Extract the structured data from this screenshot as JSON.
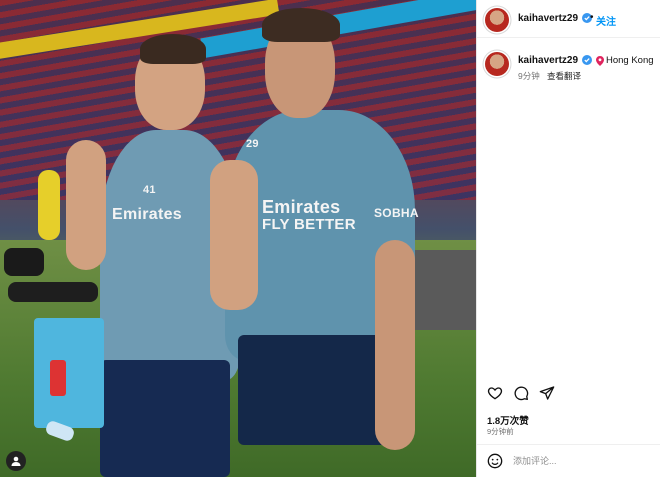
{
  "post": {
    "username": "kaihavertz29",
    "follow_label": "关注",
    "separator": "•",
    "location": "Hong Kong",
    "time_ago": "9分钟",
    "translate_label": "查看翻译",
    "likes": "1.8万次赞",
    "posted_ago": "9分钟前",
    "comment_placeholder": "添加评论..."
  },
  "photo": {
    "shirt_sponsor_1": "Emirates",
    "shirt_sponsor_2a": "Emirates",
    "shirt_sponsor_2b": "FLY BETTER",
    "sleeve_sponsor": "SOBHA",
    "number_1": "41",
    "number_2": "29"
  },
  "icons": {
    "verified": "verified-badge-icon",
    "location": "location-pin-icon",
    "like": "heart-icon",
    "comment": "comment-bubble-icon",
    "share": "paper-plane-icon",
    "emoji": "smiley-icon",
    "user_tag": "user-tag-icon"
  },
  "colors": {
    "follow_blue": "#0095f6",
    "verified_blue": "#3897f0",
    "muted_text": "#737373"
  }
}
